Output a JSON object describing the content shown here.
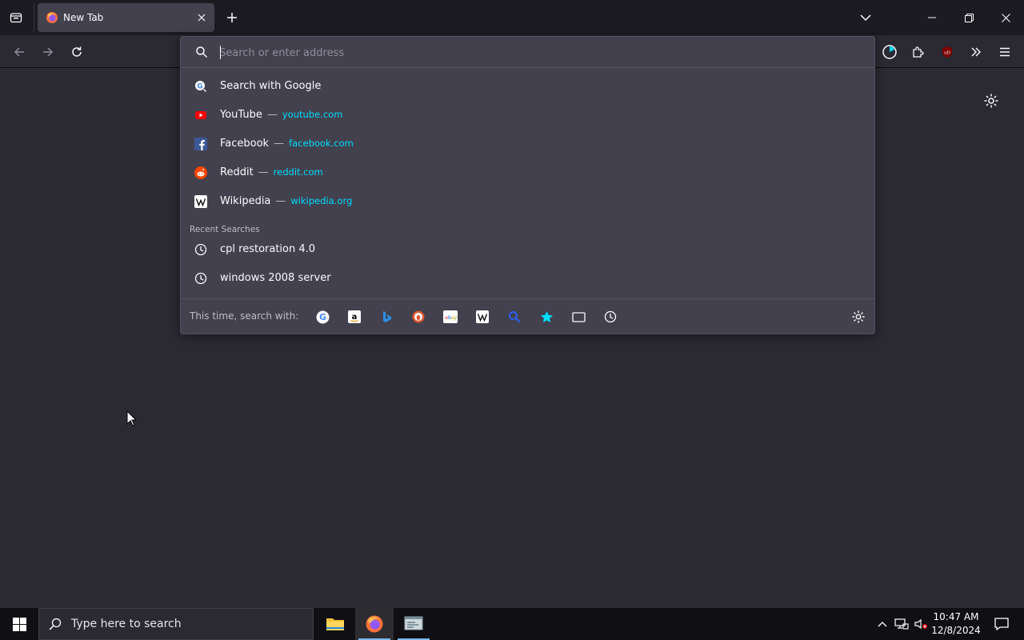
{
  "browser": {
    "tab": {
      "title": "New Tab"
    },
    "urlbar": {
      "placeholder": "Search or enter address",
      "results": [
        {
          "title": "Search with Google",
          "url": "",
          "icon": "google-search-icon"
        },
        {
          "title": "YouTube",
          "url": "youtube.com",
          "icon": "youtube-icon"
        },
        {
          "title": "Facebook",
          "url": "facebook.com",
          "icon": "facebook-icon"
        },
        {
          "title": "Reddit",
          "url": "reddit.com",
          "icon": "reddit-icon"
        },
        {
          "title": "Wikipedia",
          "url": "wikipedia.org",
          "icon": "wikipedia-icon"
        }
      ],
      "separator": "—",
      "recent_label": "Recent Searches",
      "recent": [
        {
          "title": "cpl restoration 4.0",
          "icon": "history-icon"
        },
        {
          "title": "windows 2008 server",
          "icon": "history-icon"
        }
      ],
      "oneoff_label": "This time, search with:",
      "engines": [
        "google",
        "amazon",
        "bing",
        "duckduckgo",
        "ebay",
        "wikipedia",
        "search",
        "bookmarks",
        "tabs",
        "history"
      ]
    }
  },
  "taskbar": {
    "search_placeholder": "Type here to search",
    "time": "10:47 AM",
    "date": "12/8/2024"
  },
  "colors": {
    "accent_url": "#00ddff",
    "panel": "#42414d",
    "toolbar": "#2b2a33",
    "tabstrip": "#1c1b22"
  }
}
